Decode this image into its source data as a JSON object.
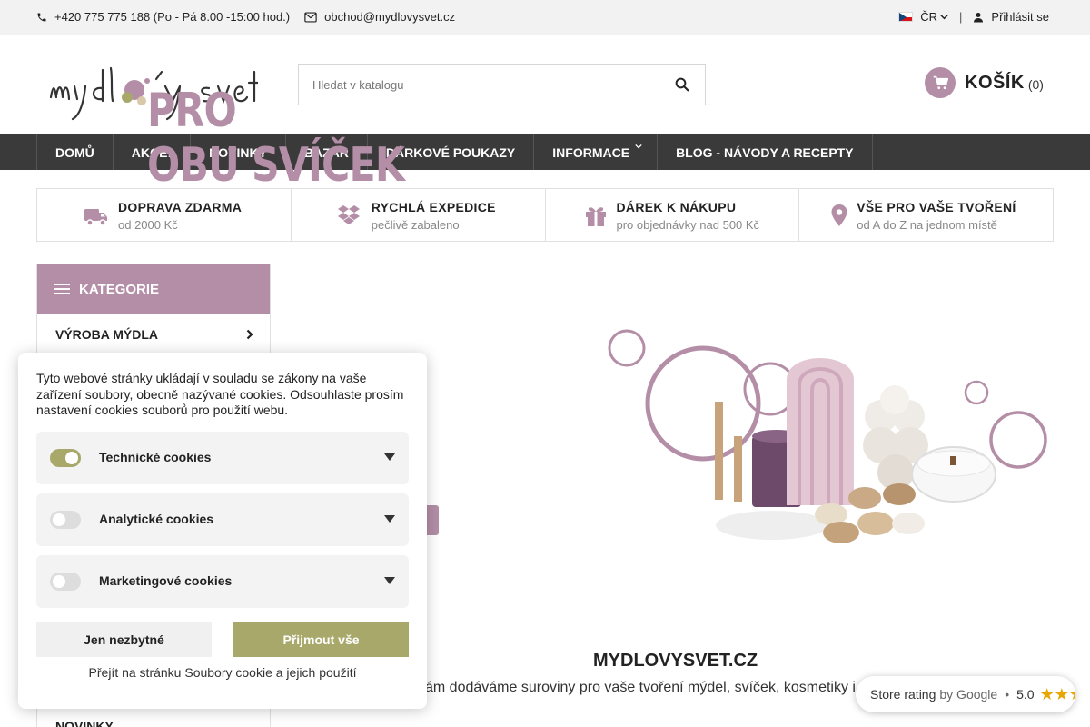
{
  "topbar": {
    "phone": "+420 775 775 188 (Po - Pá 8.00 -15:00 hod.)",
    "email": "obchod@mydlovysvet.cz",
    "language": "ČR",
    "separator": "|",
    "login": "Přihlásit se"
  },
  "header": {
    "logo_text": "mýdlový svět",
    "search_placeholder": "Hledat v katalogu",
    "cart_label": "KOŠÍK",
    "cart_count": "(0)"
  },
  "nav": {
    "items": [
      "DOMŮ",
      "AKCE!",
      "NOVINKY",
      "BAZAR",
      "DÁRKOVÉ POUKAZY",
      "INFORMACE",
      "BLOG - NÁVODY A RECEPTY"
    ]
  },
  "features": [
    {
      "title": "DOPRAVA ZDARMA",
      "subtitle": "od 2000 Kč",
      "icon": "truck-icon"
    },
    {
      "title": "RYCHLÁ EXPEDICE",
      "subtitle": "pečlivě zabaleno",
      "icon": "dropbox-icon"
    },
    {
      "title": "DÁREK K NÁKUPU",
      "subtitle": "pro objednávky nad 500 Kč",
      "icon": "gift-icon"
    },
    {
      "title": "VŠE PRO VAŠE TVOŘENÍ",
      "subtitle": "od A do Z na jednom místě",
      "icon": "map-pin-icon"
    }
  ],
  "sidebar": {
    "title": "KATEGORIE",
    "items": [
      "VÝROBA MÝDLA"
    ],
    "bottom_item": "NOVINKY"
  },
  "banner": {
    "line1": "PRO",
    "line2": "OBU SVÍČEK"
  },
  "brand": {
    "title": "MYDLOVYSVET.CZ",
    "text": "ám dodáváme suroviny pro vaše tvoření mýdel, svíček, kosmetiky i"
  },
  "cookie": {
    "intro": "Tyto webové stránky ukládají v souladu se zákony na vaše zařízení soubory, obecně nazývané cookies. Odsouhlaste prosím nastavení cookies souborů pro použití webu.",
    "categories": [
      {
        "label": "Technické cookies",
        "enabled": true
      },
      {
        "label": "Analytické cookies",
        "enabled": false
      },
      {
        "label": "Marketingové cookies",
        "enabled": false
      }
    ],
    "btn_necessary": "Jen nezbytné",
    "btn_accept": "Přijmout vše",
    "link": "Přejít na stránku Soubory cookie a jejich použití"
  },
  "rating": {
    "label": "Store rating",
    "by": "by Google",
    "dot": "•",
    "score": "5.0",
    "stars": "★★★★★"
  },
  "colors": {
    "accent": "#b38ea6",
    "accept": "#a8a86a",
    "nav_bg": "#3a3a3a"
  }
}
